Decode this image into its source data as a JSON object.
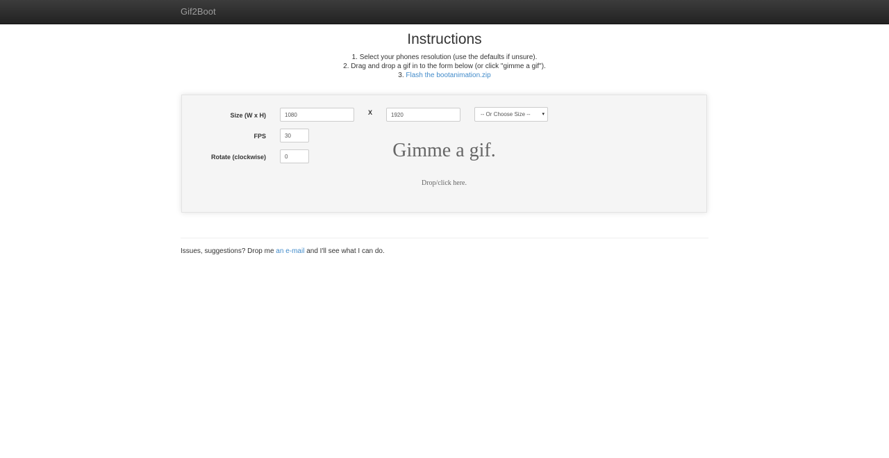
{
  "navbar": {
    "brand": "Gif2Boot"
  },
  "instructions": {
    "title": "Instructions",
    "step1": "1. Select your phones resolution (use the defaults if unsure).",
    "step2": "2. Drag and drop a gif in to the form below (or click \"gimme a gif\").",
    "step3_prefix": "3. ",
    "step3_link": "Flash the bootanimation.zip"
  },
  "form": {
    "size_label": "Size (W x H)",
    "width_value": "1080",
    "separator": "X",
    "height_value": "1920",
    "size_select": "-- Or Choose Size --",
    "select_arrow": "▾",
    "fps_label": "FPS",
    "fps_value": "30",
    "rotate_label": "Rotate (clockwise)",
    "rotate_value": "0"
  },
  "dropzone": {
    "title": "Gimme a gif.",
    "hint": "Drop/click here."
  },
  "footer": {
    "prefix": "Issues, suggestions? Drop me ",
    "link": "an e-mail",
    "suffix": " and I'll see what I can do."
  }
}
